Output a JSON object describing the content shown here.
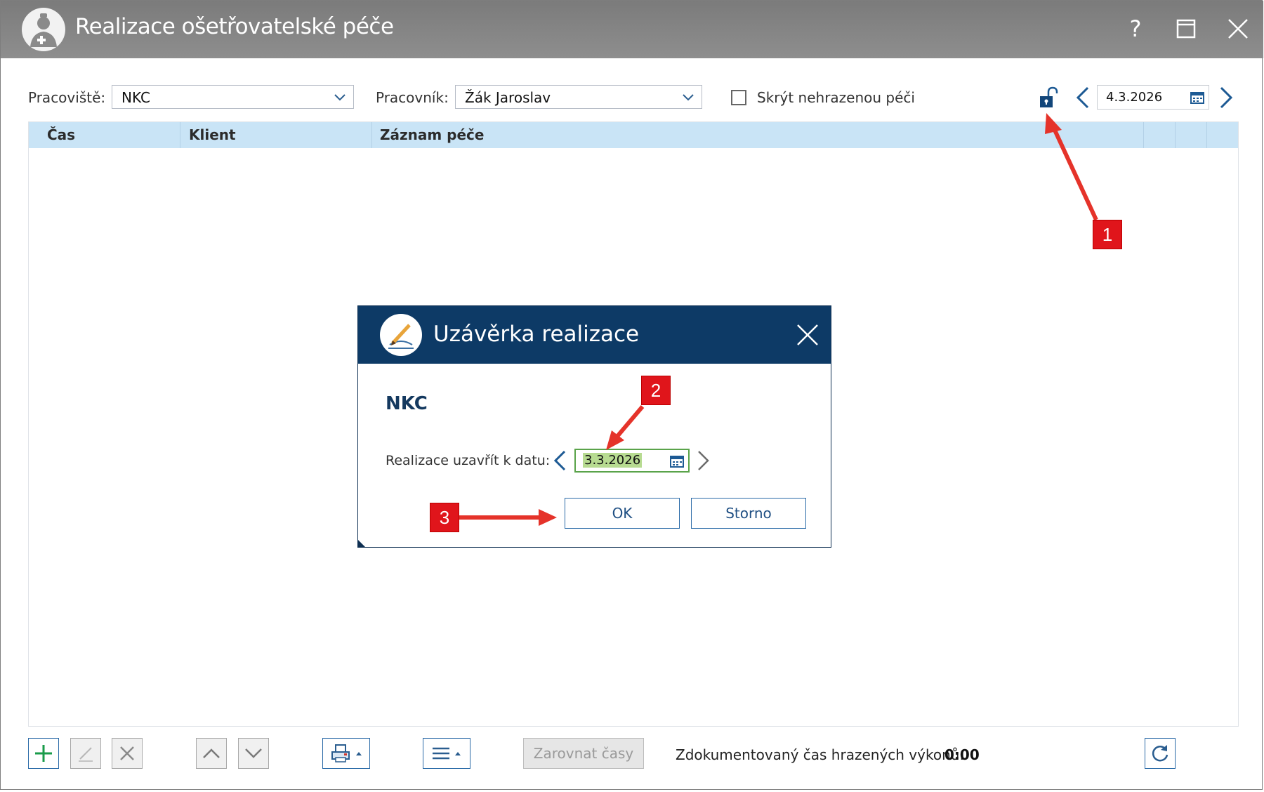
{
  "window": {
    "title": "Realizace ošetřovatelské péče",
    "help_glyph": "?",
    "icons": [
      "nurse-icon",
      "help-icon",
      "maximize-icon",
      "close-icon"
    ]
  },
  "filters": {
    "workplace_label": "Pracoviště:",
    "workplace_value": "NKC",
    "worker_label": "Pracovník:",
    "worker_value": "Žák Jaroslav",
    "hide_unpaid_label": "Skrýt nehrazenou péči",
    "hide_unpaid_checked": false,
    "date_value": "4.3.2026"
  },
  "grid": {
    "columns": [
      "Čas",
      "Klient",
      "Záznam péče"
    ],
    "rows": []
  },
  "toolbar": {
    "align_times_label": "Zarovnat časy",
    "documented_time_label": "Zdokumentovaný čas hrazených výkonů:",
    "documented_time_value": "0:00"
  },
  "dialog": {
    "title": "Uzávěrka realizace",
    "workplace": "NKC",
    "close_date_label": "Realizace uzavřít k datu:",
    "close_date_value": "3.3.2026",
    "ok_label": "OK",
    "cancel_label": "Storno"
  },
  "annotations": {
    "badges": [
      "1",
      "2",
      "3"
    ],
    "color": "#e0151b"
  },
  "colors": {
    "titlebar": "#888888",
    "dialog_header": "#0d3a66",
    "grid_header": "#c9e4f6",
    "accent_border": "#2a6aa7",
    "date_highlight": "#b7db91"
  }
}
